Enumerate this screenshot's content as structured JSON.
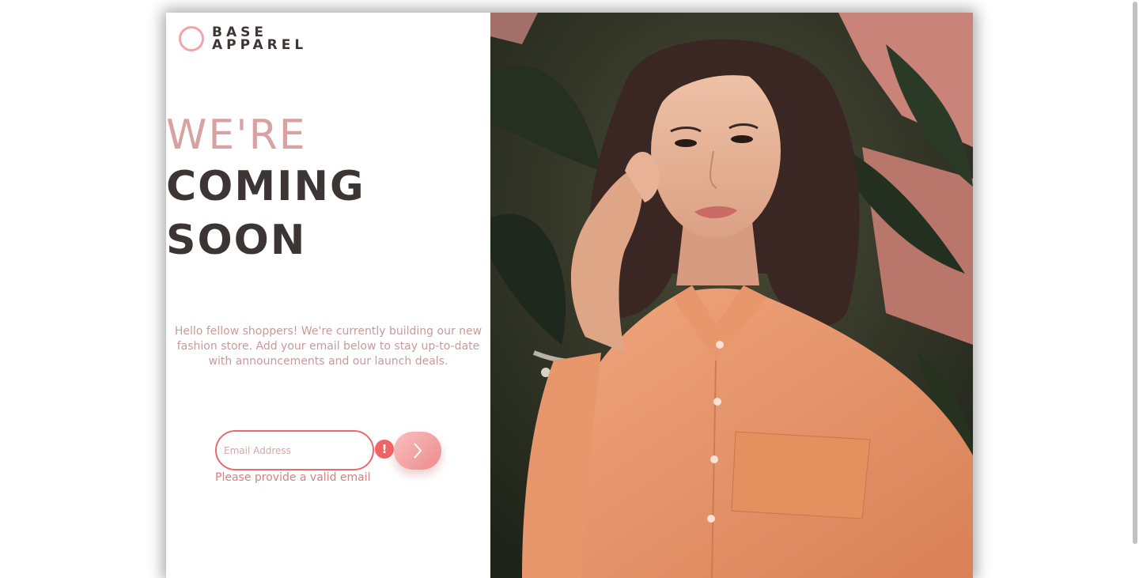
{
  "brand": {
    "line1": "BASE",
    "line2": "APPAREL"
  },
  "headline": {
    "light": "WE'RE",
    "bold_line1": "COMING",
    "bold_line2": "SOON"
  },
  "description": "Hello fellow shoppers! We're currently building our new fashion store. Add your email below to stay up-to-date with announcements and our launch deals.",
  "form": {
    "email_placeholder": "Email Address",
    "email_value": "",
    "error_icon": "!",
    "error_message": "Please provide a valid email",
    "submit_icon": "chevron-right-icon"
  },
  "hero_image": "woman-in-orange-shirt-photo",
  "colors": {
    "accent": "#f2a5a5",
    "dark_text": "#3d3535",
    "desaturated_red": "#ce9797",
    "error_red": "#f06464"
  }
}
